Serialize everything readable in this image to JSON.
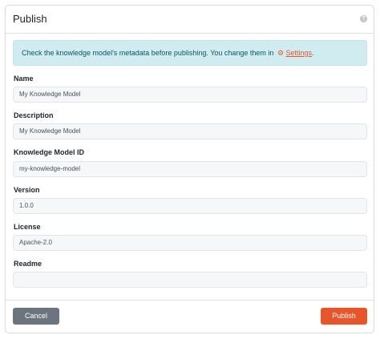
{
  "modal": {
    "title": "Publish",
    "help_icon": "help-icon"
  },
  "alert": {
    "text": "Check the knowledge model's metadata before publishing. You change them in ",
    "icon": "gear-icon",
    "link_text": "Settings",
    "suffix": "."
  },
  "fields": {
    "name": {
      "label": "Name",
      "value": "My Knowledge Model"
    },
    "description": {
      "label": "Description",
      "value": "My Knowledge Model"
    },
    "km_id": {
      "label": "Knowledge Model ID",
      "value": "my-knowledge-model"
    },
    "version": {
      "label": "Version",
      "value": "1.0.0"
    },
    "license": {
      "label": "License",
      "value": "Apache-2.0"
    },
    "readme": {
      "label": "Readme",
      "value": ""
    }
  },
  "footer": {
    "cancel_label": "Cancel",
    "publish_label": "Publish"
  },
  "colors": {
    "accent": "#e8552a",
    "alert_bg": "#d1ecf1",
    "cancel_bg": "#6c757d"
  }
}
